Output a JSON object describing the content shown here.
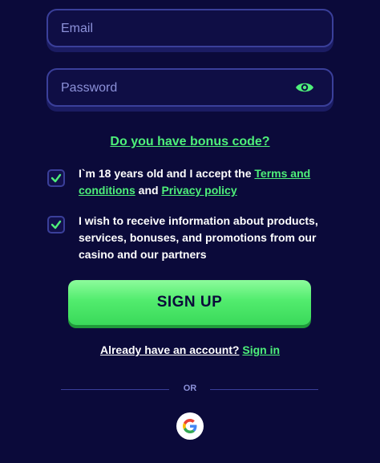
{
  "form": {
    "email_placeholder": "Email",
    "password_placeholder": "Password",
    "password_toggle_icon": "eye-icon",
    "bonus_link": "Do you have bonus code?",
    "terms": {
      "checked": true,
      "text_before": "I`m 18 years old and I accept the ",
      "terms_link": "Terms and conditions",
      "middle": " and ",
      "privacy_link": "Privacy policy"
    },
    "marketing": {
      "checked": true,
      "text": "I wish to receive information about products, services, bonuses, and promotions from our casino and our partners"
    },
    "signup_label": "SIGN UP",
    "signin_prompt": "Already have an account?",
    "signin_link": "Sign in",
    "divider_label": "OR",
    "social_icon": "google-icon"
  },
  "colors": {
    "background": "#0b0a3a",
    "accent_green": "#4ef07a",
    "field_border": "#3a3f9a"
  }
}
